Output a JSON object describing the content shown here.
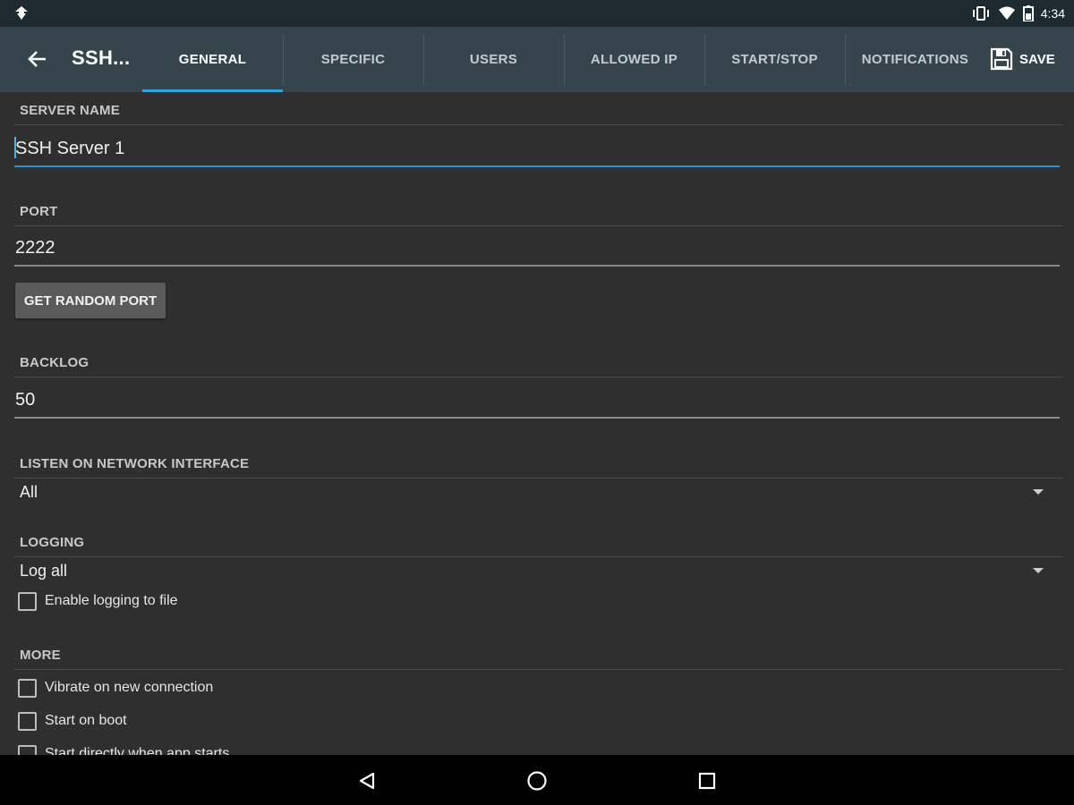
{
  "status_bar": {
    "time": "4:34",
    "icons": [
      "notification-icon",
      "vibrate-icon",
      "wifi-icon",
      "battery-icon"
    ]
  },
  "app_bar": {
    "title": "SSH...",
    "tabs": [
      {
        "label": "GENERAL",
        "active": true
      },
      {
        "label": "SPECIFIC",
        "active": false
      },
      {
        "label": "USERS",
        "active": false
      },
      {
        "label": "ALLOWED IP",
        "active": false
      },
      {
        "label": "START/STOP",
        "active": false
      },
      {
        "label": "NOTIFICATIONS",
        "active": false
      }
    ],
    "save_label": "SAVE",
    "accent_color": "#33a3dc"
  },
  "form": {
    "server_name": {
      "header": "SERVER NAME",
      "value": "SSH Server 1"
    },
    "port": {
      "header": "PORT",
      "value": "2222",
      "button_label": "GET RANDOM PORT"
    },
    "backlog": {
      "header": "BACKLOG",
      "value": "50"
    },
    "network_interface": {
      "header": "LISTEN ON NETWORK INTERFACE",
      "selected": "All"
    },
    "logging": {
      "header": "LOGGING",
      "selected": "Log all",
      "log_to_file": {
        "label": "Enable logging to file",
        "checked": false
      }
    },
    "more": {
      "header": "MORE",
      "options": [
        {
          "label": "Vibrate on new connection",
          "checked": false
        },
        {
          "label": "Start on boot",
          "checked": false
        },
        {
          "label": "Start directly when app starts",
          "checked": false
        }
      ]
    }
  }
}
